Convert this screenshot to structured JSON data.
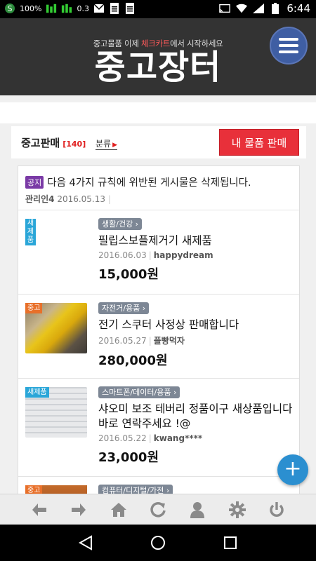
{
  "status_bar": {
    "battery_small_label": "100%",
    "signal_value": "0.3",
    "time": "6:44"
  },
  "header": {
    "subtitle_prefix": "중고물품 이제 ",
    "subtitle_highlight": "체크카트",
    "subtitle_suffix": "에서 시작하세요",
    "title": "중고장터",
    "menu_icon": "hamburger-icon",
    "menu_color": "#3f5ea3"
  },
  "section": {
    "title": "중고판매",
    "count": "[140]",
    "sort_label": "분류",
    "sell_button": "내 물품 판매",
    "sell_button_color": "#e8303a"
  },
  "notice": {
    "tag": "공지",
    "text": "다음 4가지 규칙에 위반된 게시물은 삭제됩니다.",
    "author": "관리인4",
    "date": "2016.05.13"
  },
  "items": [
    {
      "badge": "새제품",
      "category": "생활/건강",
      "title": "필립스보플제거기 새제품",
      "date": "2016.06.03",
      "user": "happydream",
      "price": "15,000원"
    },
    {
      "badge": "중고",
      "category": "자전거/용품",
      "title": "전기 스쿠터 사정상 판매합니다",
      "date": "2016.05.27",
      "user": "플빵먹자",
      "price": "280,000원"
    },
    {
      "badge": "새제품",
      "category": "스마트폰/데이터/용품",
      "title": "샤오미 보조 테버리 정품이구 새상품입니다 바로 연락주세요 !@",
      "date": "2016.05.22",
      "user": "kwang****",
      "price": "23,000원"
    },
    {
      "badge": "중고",
      "category": "컴퓨터/디지털/가전"
    }
  ],
  "fab_label": "+",
  "toolbar": [
    "back-arrow-icon",
    "forward-arrow-icon",
    "home-icon",
    "refresh-icon",
    "user-icon",
    "settings-icon",
    "power-icon"
  ],
  "nav": [
    "back-triangle-icon",
    "home-circle-icon",
    "recents-square-icon"
  ]
}
